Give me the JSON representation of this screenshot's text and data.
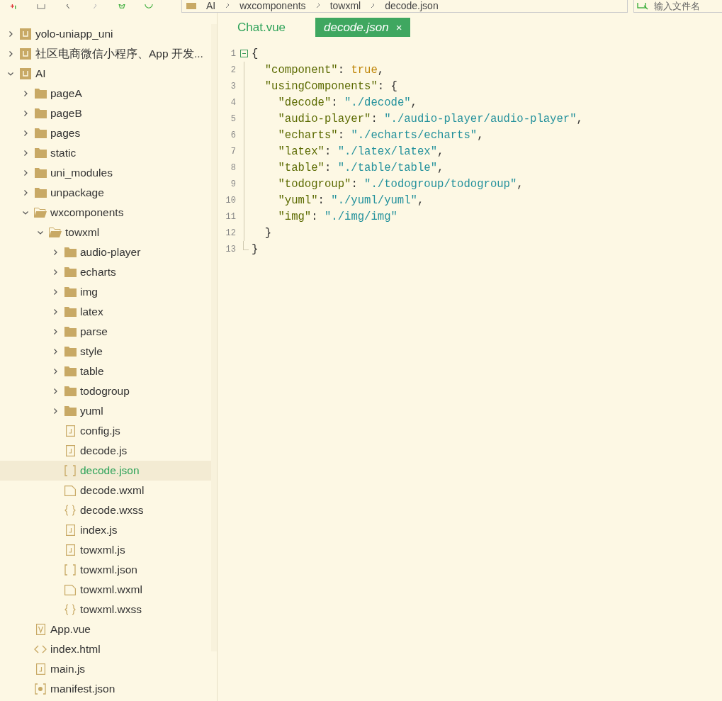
{
  "toolbar": {
    "breadcrumb": [
      "AI",
      "wxcomponents",
      "towxml",
      "decode.json"
    ],
    "search": {
      "placeholder": "输入文件名"
    }
  },
  "tree": [
    {
      "label": "yolo-uniapp_uni",
      "kind": "project",
      "expanded": false,
      "selected": false
    },
    {
      "label": "社区电商微信小程序、App 开发...",
      "kind": "project",
      "expanded": false,
      "selected": false
    },
    {
      "label": "AI",
      "kind": "project",
      "expanded": true,
      "selected": false,
      "children": [
        {
          "label": "pageA",
          "kind": "folder",
          "expanded": false,
          "selected": false
        },
        {
          "label": "pageB",
          "kind": "folder",
          "expanded": false,
          "selected": false
        },
        {
          "label": "pages",
          "kind": "folder",
          "expanded": false,
          "selected": false
        },
        {
          "label": "static",
          "kind": "folder",
          "expanded": false,
          "selected": false
        },
        {
          "label": "uni_modules",
          "kind": "folder",
          "expanded": false,
          "selected": false
        },
        {
          "label": "unpackage",
          "kind": "folder",
          "expanded": false,
          "selected": false
        },
        {
          "label": "wxcomponents",
          "kind": "folder",
          "expanded": true,
          "selected": false,
          "children": [
            {
              "label": "towxml",
              "kind": "folder",
              "expanded": true,
              "selected": false,
              "children": [
                {
                  "label": "audio-player",
                  "kind": "folder",
                  "expanded": false,
                  "selected": false
                },
                {
                  "label": "echarts",
                  "kind": "folder",
                  "expanded": false,
                  "selected": false
                },
                {
                  "label": "img",
                  "kind": "folder",
                  "expanded": false,
                  "selected": false
                },
                {
                  "label": "latex",
                  "kind": "folder",
                  "expanded": false,
                  "selected": false
                },
                {
                  "label": "parse",
                  "kind": "folder",
                  "expanded": false,
                  "selected": false
                },
                {
                  "label": "style",
                  "kind": "folder",
                  "expanded": false,
                  "selected": false
                },
                {
                  "label": "table",
                  "kind": "folder",
                  "expanded": false,
                  "selected": false
                },
                {
                  "label": "todogroup",
                  "kind": "folder",
                  "expanded": false,
                  "selected": false
                },
                {
                  "label": "yuml",
                  "kind": "folder",
                  "expanded": false,
                  "selected": false
                },
                {
                  "label": "config.js",
                  "kind": "js",
                  "selected": false
                },
                {
                  "label": "decode.js",
                  "kind": "js",
                  "selected": false
                },
                {
                  "label": "decode.json",
                  "kind": "json",
                  "selected": true
                },
                {
                  "label": "decode.wxml",
                  "kind": "page",
                  "selected": false
                },
                {
                  "label": "decode.wxss",
                  "kind": "css",
                  "selected": false
                },
                {
                  "label": "index.js",
                  "kind": "js",
                  "selected": false
                },
                {
                  "label": "towxml.js",
                  "kind": "js",
                  "selected": false
                },
                {
                  "label": "towxml.json",
                  "kind": "json",
                  "selected": false
                },
                {
                  "label": "towxml.wxml",
                  "kind": "page",
                  "selected": false
                },
                {
                  "label": "towxml.wxss",
                  "kind": "css",
                  "selected": false
                }
              ]
            }
          ]
        },
        {
          "label": "App.vue",
          "kind": "vue",
          "selected": false
        },
        {
          "label": "index.html",
          "kind": "html",
          "selected": false
        },
        {
          "label": "main.js",
          "kind": "js",
          "selected": false
        },
        {
          "label": "manifest.json",
          "kind": "manifest",
          "selected": false
        }
      ]
    }
  ],
  "tabs": [
    {
      "label": "Chat.vue",
      "selected": false
    },
    {
      "label": "decode.json",
      "selected": true,
      "closable": true,
      "close": "×"
    }
  ],
  "code": [
    {
      "number": "1",
      "fold": true,
      "tokens": [
        {
          "kind": "punct",
          "text": "{"
        }
      ]
    },
    {
      "number": "2",
      "tokens": [
        {
          "kind": "key",
          "text": "  \"component\""
        },
        {
          "kind": "punct",
          "text": ": "
        },
        {
          "kind": "literal",
          "text": "true"
        },
        {
          "kind": "punct",
          "text": ","
        }
      ]
    },
    {
      "number": "3",
      "tokens": [
        {
          "kind": "key",
          "text": "  \"usingComponents\""
        },
        {
          "kind": "punct",
          "text": ": {"
        }
      ]
    },
    {
      "number": "4",
      "tokens": [
        {
          "kind": "key",
          "text": "    \"decode\""
        },
        {
          "kind": "punct",
          "text": ": "
        },
        {
          "kind": "string",
          "text": "\"./decode\""
        },
        {
          "kind": "punct",
          "text": ","
        }
      ]
    },
    {
      "number": "5",
      "tokens": [
        {
          "kind": "key",
          "text": "    \"audio-player\""
        },
        {
          "kind": "punct",
          "text": ": "
        },
        {
          "kind": "string",
          "text": "\"./audio-player/audio-player\""
        },
        {
          "kind": "punct",
          "text": ","
        }
      ]
    },
    {
      "number": "6",
      "tokens": [
        {
          "kind": "key",
          "text": "    \"echarts\""
        },
        {
          "kind": "punct",
          "text": ": "
        },
        {
          "kind": "string",
          "text": "\"./echarts/echarts\""
        },
        {
          "kind": "punct",
          "text": ","
        }
      ]
    },
    {
      "number": "7",
      "tokens": [
        {
          "kind": "key",
          "text": "    \"latex\""
        },
        {
          "kind": "punct",
          "text": ": "
        },
        {
          "kind": "string",
          "text": "\"./latex/latex\""
        },
        {
          "kind": "punct",
          "text": ","
        }
      ]
    },
    {
      "number": "8",
      "tokens": [
        {
          "kind": "key",
          "text": "    \"table\""
        },
        {
          "kind": "punct",
          "text": ": "
        },
        {
          "kind": "string",
          "text": "\"./table/table\""
        },
        {
          "kind": "punct",
          "text": ","
        }
      ]
    },
    {
      "number": "9",
      "tokens": [
        {
          "kind": "key",
          "text": "    \"todogroup\""
        },
        {
          "kind": "punct",
          "text": ": "
        },
        {
          "kind": "string",
          "text": "\"./todogroup/todogroup\""
        },
        {
          "kind": "punct",
          "text": ","
        }
      ]
    },
    {
      "number": "10",
      "tokens": [
        {
          "kind": "key",
          "text": "    \"yuml\""
        },
        {
          "kind": "punct",
          "text": ": "
        },
        {
          "kind": "string",
          "text": "\"./yuml/yuml\""
        },
        {
          "kind": "punct",
          "text": ","
        }
      ]
    },
    {
      "number": "11",
      "tokens": [
        {
          "kind": "key",
          "text": "    \"img\""
        },
        {
          "kind": "punct",
          "text": ": "
        },
        {
          "kind": "string",
          "text": "\"./img/img\""
        }
      ]
    },
    {
      "number": "12",
      "tokens": [
        {
          "kind": "punct",
          "text": "  }"
        }
      ]
    },
    {
      "number": "13",
      "tokens": [
        {
          "kind": "punct",
          "text": "}"
        }
      ]
    }
  ]
}
